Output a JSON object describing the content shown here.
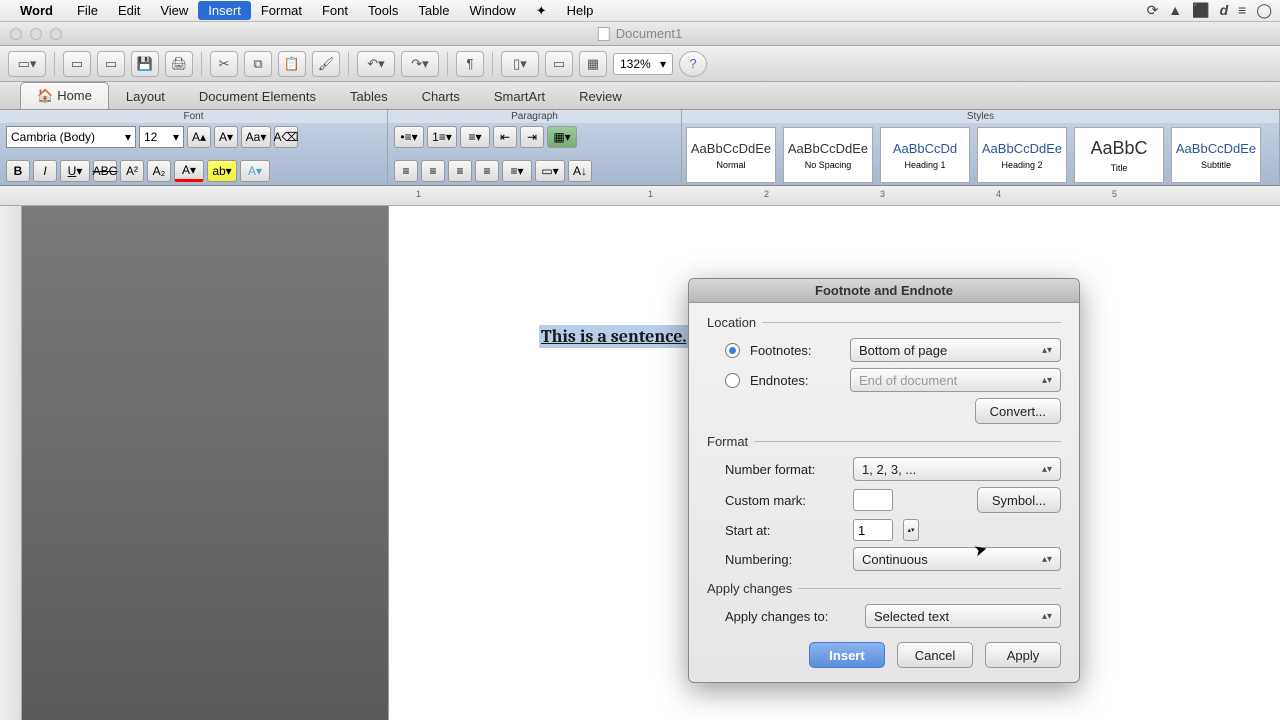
{
  "menubar": {
    "app": "Word",
    "items": [
      "File",
      "Edit",
      "View",
      "Insert",
      "Format",
      "Font",
      "Tools",
      "Table",
      "Window",
      "",
      "Help"
    ],
    "active": "Insert"
  },
  "window": {
    "title": "Document1"
  },
  "toolbar": {
    "zoom": "132%"
  },
  "tabs": {
    "items": [
      "Home",
      "Layout",
      "Document Elements",
      "Tables",
      "Charts",
      "SmartArt",
      "Review"
    ],
    "active": "Home"
  },
  "ribbon": {
    "groups": {
      "font": "Font",
      "paragraph": "Paragraph",
      "styles": "Styles"
    },
    "font_name": "Cambria (Body)",
    "font_size": "12",
    "styles": [
      {
        "preview": "AaBbCcDdEe",
        "name": "Normal"
      },
      {
        "preview": "AaBbCcDdEe",
        "name": "No Spacing"
      },
      {
        "preview": "AaBbCcDd",
        "name": "Heading 1"
      },
      {
        "preview": "AaBbCcDdEe",
        "name": "Heading 2"
      },
      {
        "preview": "AaBbC",
        "name": "Title"
      },
      {
        "preview": "AaBbCcDdEe",
        "name": "Subtitle"
      }
    ]
  },
  "ruler": {
    "marks": [
      "1",
      "1",
      "2",
      "3",
      "4",
      "5"
    ]
  },
  "document": {
    "text": "This is a sentence."
  },
  "dialog": {
    "title": "Footnote and Endnote",
    "location": {
      "label": "Location",
      "footnotes_label": "Footnotes:",
      "footnotes_value": "Bottom of page",
      "endnotes_label": "Endnotes:",
      "endnotes_value": "End of document",
      "convert": "Convert..."
    },
    "format": {
      "label": "Format",
      "number_format_label": "Number format:",
      "number_format_value": "1, 2, 3, ...",
      "custom_mark_label": "Custom mark:",
      "custom_mark_value": "",
      "symbol": "Symbol...",
      "start_at_label": "Start at:",
      "start_at_value": "1",
      "numbering_label": "Numbering:",
      "numbering_value": "Continuous"
    },
    "apply": {
      "label": "Apply changes",
      "to_label": "Apply changes to:",
      "to_value": "Selected text"
    },
    "buttons": {
      "insert": "Insert",
      "cancel": "Cancel",
      "apply": "Apply"
    }
  }
}
